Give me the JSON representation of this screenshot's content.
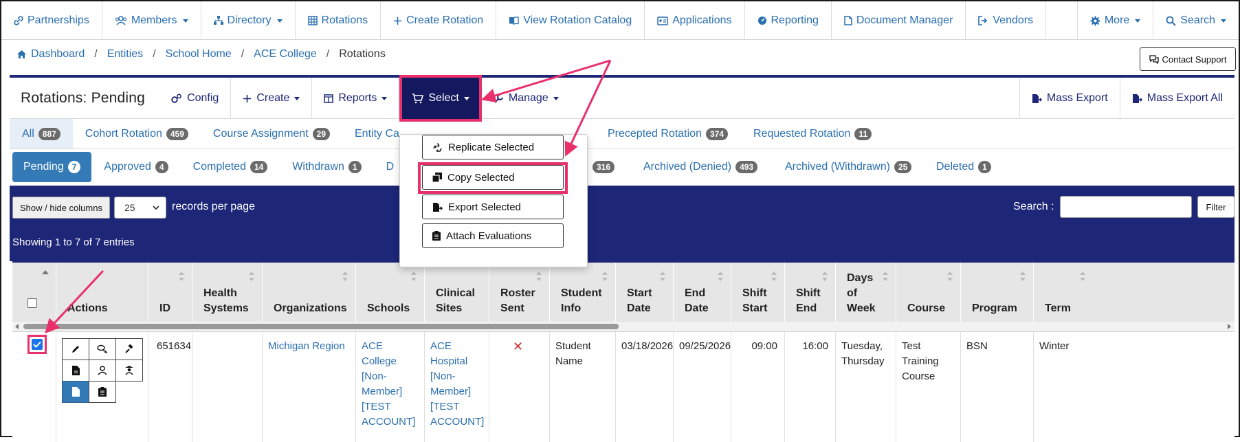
{
  "topnav": {
    "items": [
      {
        "label": "Partnerships",
        "icon": "link-icon"
      },
      {
        "label": "Members",
        "icon": "users-icon",
        "caret": true
      },
      {
        "label": "Directory",
        "icon": "sitemap-icon",
        "caret": true
      },
      {
        "label": "Rotations",
        "icon": "grid-icon"
      },
      {
        "label": "Create Rotation",
        "icon": "plus-icon"
      },
      {
        "label": "View Rotation Catalog",
        "icon": "book-icon"
      },
      {
        "label": "Applications",
        "icon": "id-card-icon"
      },
      {
        "label": "Reporting",
        "icon": "dashboard-icon"
      },
      {
        "label": "Document Manager",
        "icon": "file-icon"
      },
      {
        "label": "Vendors",
        "icon": "sign-out-icon"
      }
    ],
    "more_label": "More",
    "search_label": "Search"
  },
  "breadcrumb": {
    "items": [
      "Dashboard",
      "Entities",
      "School Home",
      "ACE College"
    ],
    "current": "Rotations"
  },
  "contact_support": "Contact Support",
  "panel": {
    "title": "Rotations: Pending",
    "config": "Config",
    "create": "Create",
    "reports": "Reports",
    "select": "Select",
    "manage": "Manage",
    "mass_export": "Mass Export",
    "mass_export_all": "Mass Export All"
  },
  "tabs1": [
    {
      "label": "All",
      "count": "887"
    },
    {
      "label": "Cohort Rotation",
      "count": "459"
    },
    {
      "label": "Course Assignment",
      "count": "29"
    },
    {
      "label": "Entity Ca",
      "count": ""
    },
    {
      "label": "Precepted Rotation",
      "count": "374"
    },
    {
      "label": "Requested Rotation",
      "count": "11"
    }
  ],
  "tabs2": [
    {
      "label": "Pending",
      "count": "7"
    },
    {
      "label": "Approved",
      "count": "4"
    },
    {
      "label": "Completed",
      "count": "14"
    },
    {
      "label": "Withdrawn",
      "count": "1"
    },
    {
      "label": "D",
      "count": ""
    },
    {
      "label": "",
      "count": "316"
    },
    {
      "label": "Archived (Denied)",
      "count": "493"
    },
    {
      "label": "Archived (Withdrawn)",
      "count": "25"
    },
    {
      "label": "Deleted",
      "count": "1"
    }
  ],
  "toolbar": {
    "show_hide": "Show / hide columns",
    "per_page_value": "25",
    "per_page_label": "records per page",
    "search_label": "Search :",
    "filter": "Filter",
    "showing": "Showing 1 to 7 of 7 entries"
  },
  "dropdown": {
    "items": [
      "Replicate Selected",
      "Copy Selected",
      "Export Selected",
      "Attach Evaluations"
    ]
  },
  "columns": [
    "Actions",
    "ID",
    "Health Systems",
    "Organizations",
    "Schools",
    "Clinical Sites",
    "Roster Sent",
    "Student Info",
    "Start Date",
    "End Date",
    "Shift Start",
    "Shift End",
    "Days of Week",
    "Course",
    "Program",
    "Term"
  ],
  "row": {
    "id": "651634",
    "health_systems": "",
    "organization": "Michigan Region",
    "school": "ACE College [Non-Member] [TEST ACCOUNT]",
    "clinical_site": "ACE Hospital [Non-Member] [TEST ACCOUNT]",
    "roster_sent": "✕",
    "student_info": "Student Name",
    "start_date": "03/18/2026",
    "end_date": "09/25/2026",
    "shift_start": "09:00",
    "shift_end": "16:00",
    "days_of_week": "Tuesday, Thursday",
    "course": "Test Training Course",
    "program": "BSN",
    "term": "Winter"
  },
  "colors": {
    "navy": "#1d2677",
    "highlight": "#e8306b",
    "link": "#2a6fb0"
  }
}
